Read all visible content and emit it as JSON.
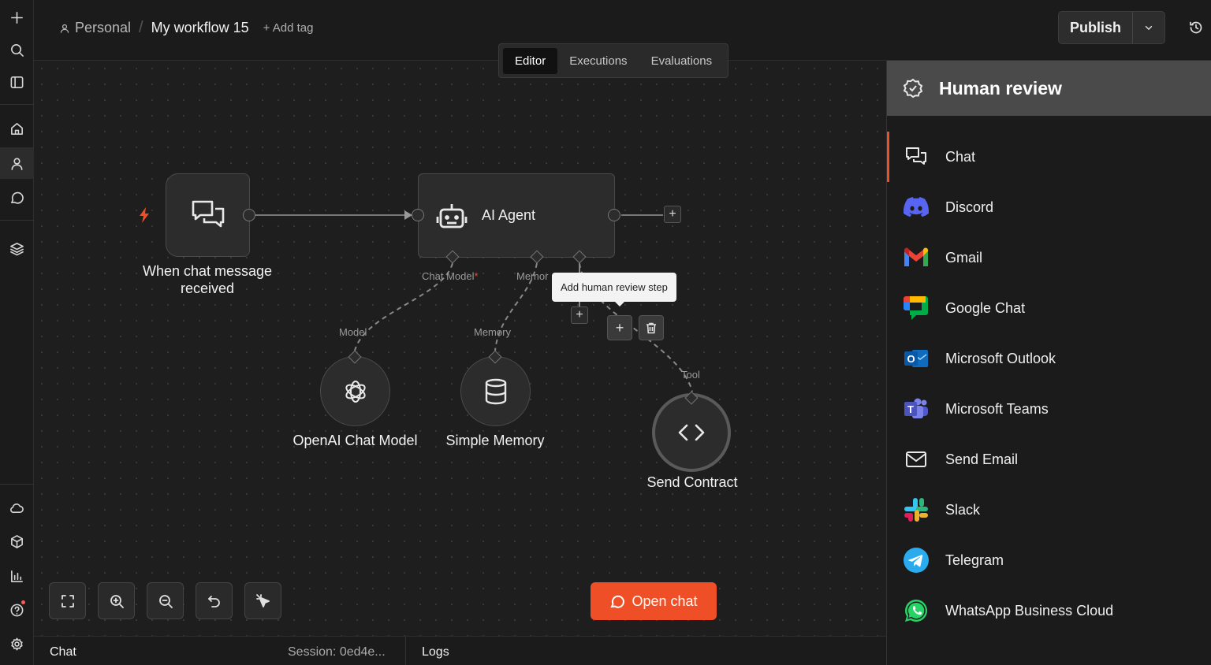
{
  "header": {
    "project": "Personal",
    "workflow_name": "My workflow 15",
    "add_tag": "+ Add tag",
    "tabs": [
      "Editor",
      "Executions",
      "Evaluations"
    ],
    "publish_label": "Publish"
  },
  "canvas": {
    "trigger_label": "When chat message received",
    "agent_label": "AI Agent",
    "port_chat_model": "Chat Model",
    "required_mark": "*",
    "port_memory": "Memor",
    "model_label": "Model",
    "memory_label": "Memory",
    "tool_label": "Tool",
    "openai_label": "OpenAI Chat Model",
    "memory_node_label": "Simple Memory",
    "send_label": "Send Contract",
    "tooltip": "Add human review step",
    "plus": "+",
    "open_chat": "Open chat"
  },
  "bottom": {
    "chat": "Chat",
    "session": "Session: 0ed4e...",
    "logs": "Logs"
  },
  "panel": {
    "title": "Human review",
    "items": [
      {
        "label": "Chat",
        "icon": "chat-icon"
      },
      {
        "label": "Discord",
        "icon": "discord-icon"
      },
      {
        "label": "Gmail",
        "icon": "gmail-icon"
      },
      {
        "label": "Google Chat",
        "icon": "google-chat-icon"
      },
      {
        "label": "Microsoft Outlook",
        "icon": "outlook-icon"
      },
      {
        "label": "Microsoft Teams",
        "icon": "teams-icon"
      },
      {
        "label": "Send Email",
        "icon": "email-icon"
      },
      {
        "label": "Slack",
        "icon": "slack-icon"
      },
      {
        "label": "Telegram",
        "icon": "telegram-icon"
      },
      {
        "label": "WhatsApp Business Cloud",
        "icon": "whatsapp-icon"
      }
    ]
  },
  "colors": {
    "accent": "#ee4f27",
    "panel_header": "#4a4a4a",
    "discord": "#5865f2",
    "telegram": "#2aabee",
    "whatsapp": "#25d366"
  }
}
